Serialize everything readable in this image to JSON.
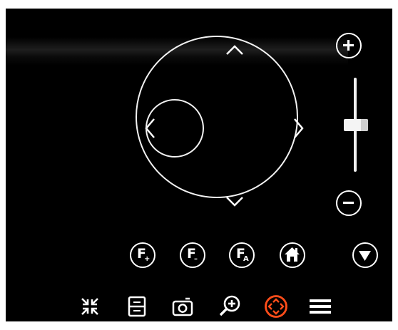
{
  "ptz": {
    "icons": {
      "up": "chevron-up-icon",
      "down": "chevron-down-icon",
      "left": "chevron-left-icon",
      "right": "chevron-right-icon"
    }
  },
  "zoom": {
    "in_icon": "plus-icon",
    "out_icon": "minus-icon",
    "level": 0.5
  },
  "focus_buttons": [
    {
      "main": "F",
      "sub": "+"
    },
    {
      "main": "F",
      "sub": "–"
    },
    {
      "main": "F",
      "sub": "A"
    }
  ],
  "toolbar": {
    "icons": [
      "collapse-icon",
      "layout-icon",
      "camera-snapshot-icon",
      "zoom-in-icon",
      "ptz-control-icon",
      "menu-icon"
    ],
    "active": "ptz-control-icon"
  },
  "colors": {
    "background": "#000000",
    "foreground": "#ffffff",
    "accent": "#ff4d1a"
  }
}
